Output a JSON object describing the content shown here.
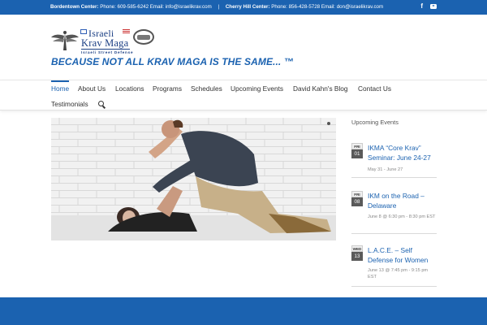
{
  "topbar": {
    "center1_label": "Bordentown Center:",
    "center1_details": "Phone: 609-585-6242 Email: info@israelikrav.com",
    "separator": "|",
    "center2_label": "Cherry Hill Center:",
    "center2_details": "Phone: 856-428-5728 Email: don@israelikrav.com",
    "icons": [
      "facebook-icon",
      "youtube-icon"
    ],
    "facebook_glyph": "f"
  },
  "logo": {
    "line1": "Israeli",
    "line2": "Krav Maga",
    "subtitle": "Israeli Street Defense"
  },
  "tagline": "BECAUSE NOT ALL KRAV MAGA IS THE SAME...  ™",
  "nav": {
    "items": [
      "Home",
      "About Us",
      "Locations",
      "Programs",
      "Schedules",
      "Upcoming Events",
      "David Kahn's Blog",
      "Contact Us",
      "Testimonials"
    ],
    "active": "Home"
  },
  "sidebar": {
    "title": "Upcoming Events",
    "events": [
      {
        "dow": "FRI",
        "dom": "01",
        "title": "IKMA “Core Krav” Seminar: June 24-27",
        "meta": "May 31 - June 27"
      },
      {
        "dow": "FRI",
        "dom": "08",
        "title": "IKM on the Road – Delaware",
        "meta": "June 8 @ 6:30 pm - 8:30 pm EST"
      },
      {
        "dow": "WED",
        "dom": "13",
        "title": "L.A.C.E. – Self Defense for Women",
        "meta": "June 13 @ 7:45 pm - 9:15 pm EST"
      }
    ]
  },
  "colors": {
    "brand_blue": "#1b62b0",
    "text": "#333333"
  }
}
